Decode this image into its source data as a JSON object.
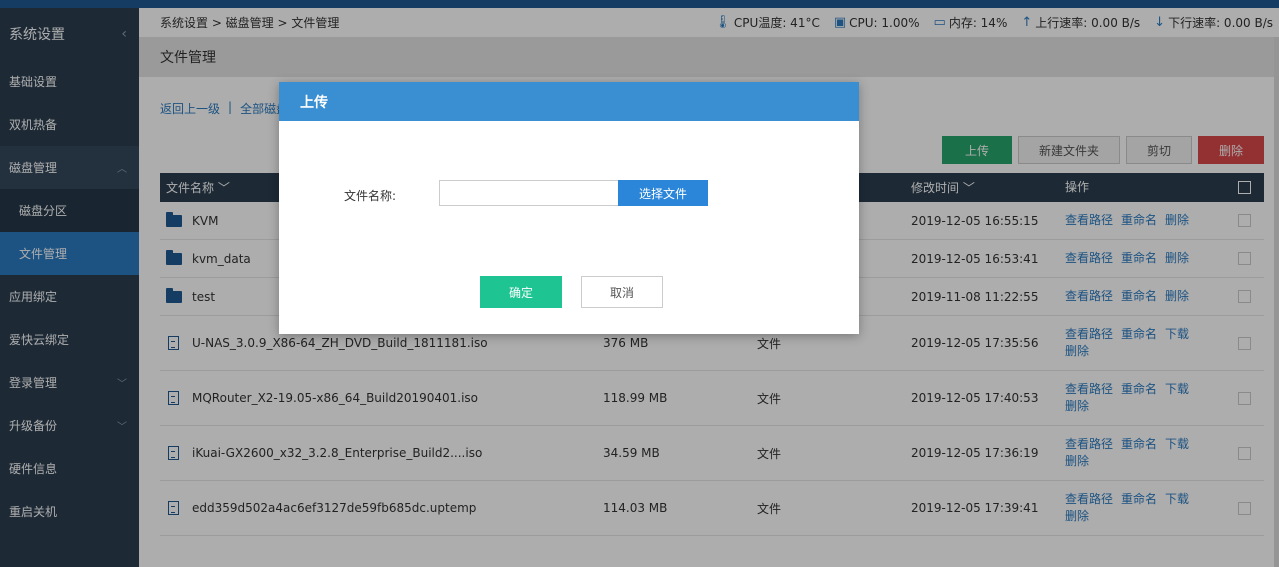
{
  "sidebar": {
    "title": "系统设置",
    "collapse_icon": "‹",
    "items": [
      {
        "label": "基础设置",
        "chevron": ""
      },
      {
        "label": "双机热备",
        "chevron": ""
      },
      {
        "label": "磁盘管理",
        "chevron": "︿"
      },
      {
        "label": "磁盘分区",
        "chevron": ""
      },
      {
        "label": "文件管理",
        "chevron": ""
      },
      {
        "label": "应用绑定",
        "chevron": ""
      },
      {
        "label": "爱快云绑定",
        "chevron": ""
      },
      {
        "label": "登录管理",
        "chevron": "﹀"
      },
      {
        "label": "升级备份",
        "chevron": "﹀"
      },
      {
        "label": "硬件信息",
        "chevron": ""
      },
      {
        "label": "重启关机",
        "chevron": ""
      }
    ]
  },
  "status": {
    "breadcrumb": "系统设置 > 磁盘管理 > 文件管理",
    "cpu_temp": "CPU温度: 41°C",
    "cpu": "CPU: 1.00%",
    "mem": "内存: 14%",
    "up": "上行速率: 0.00 B/s",
    "down": "下行速率: 0.00 B/s"
  },
  "page": {
    "title": "文件管理",
    "back_link": "返回上一级",
    "sep": "|",
    "all_link": "全部磁盘"
  },
  "toolbar": {
    "upload": "上传",
    "new_folder": "新建文件夹",
    "cut": "剪切",
    "delete": "删除"
  },
  "table": {
    "headers": {
      "name": "文件名称 ﹀",
      "mtime": "修改时间 ﹀",
      "ops": "操作"
    },
    "rows": [
      {
        "name": "KVM",
        "size": "",
        "type": "",
        "mtime": "2019-12-05 16:55:15",
        "op1": "查看路径",
        "op2": "重命名",
        "op3": "删除",
        "op4": ""
      },
      {
        "name": "kvm_data",
        "size": "",
        "type": "",
        "mtime": "2019-12-05 16:53:41",
        "op1": "查看路径",
        "op2": "重命名",
        "op3": "删除",
        "op4": ""
      },
      {
        "name": "test",
        "size": "",
        "type": "",
        "mtime": "2019-11-08 11:22:55",
        "op1": "查看路径",
        "op2": "重命名",
        "op3": "删除",
        "op4": ""
      },
      {
        "name": "U-NAS_3.0.9_X86-64_ZH_DVD_Build_1811181.iso",
        "size": "376 MB",
        "type": "文件",
        "mtime": "2019-12-05 17:35:56",
        "op1": "查看路径",
        "op2": "重命名",
        "op3": "下载",
        "op4": "删除"
      },
      {
        "name": "MQRouter_X2-19.05-x86_64_Build20190401.iso",
        "size": "118.99 MB",
        "type": "文件",
        "mtime": "2019-12-05 17:40:53",
        "op1": "查看路径",
        "op2": "重命名",
        "op3": "下载",
        "op4": "删除"
      },
      {
        "name": "iKuai-GX2600_x32_3.2.8_Enterprise_Build2....iso",
        "size": "34.59 MB",
        "type": "文件",
        "mtime": "2019-12-05 17:36:19",
        "op1": "查看路径",
        "op2": "重命名",
        "op3": "下载",
        "op4": "删除"
      },
      {
        "name": "edd359d502a4ac6ef3127de59fb685dc.uptemp",
        "size": "114.03 MB",
        "type": "文件",
        "mtime": "2019-12-05 17:39:41",
        "op1": "查看路径",
        "op2": "重命名",
        "op3": "下载",
        "op4": "删除"
      }
    ]
  },
  "modal": {
    "title": "上传",
    "label": "文件名称:",
    "file_value": "",
    "pick": "选择文件",
    "ok": "确定",
    "cancel": "取消"
  },
  "colors": {
    "sidebar_bg": "#2c3e50",
    "accent": "#2b7bc0",
    "modal_header": "#3a8fd3",
    "confirm": "#1ec592",
    "upload": "#27a66a",
    "delete": "#d9484b"
  }
}
